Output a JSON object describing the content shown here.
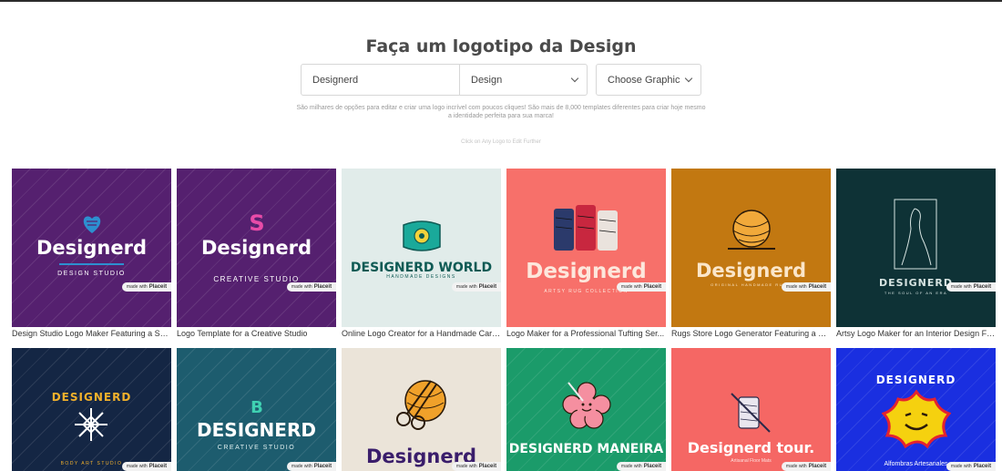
{
  "header": {
    "title": "Faça um logotipo da Design",
    "search_value": "Designerd",
    "category_select": "Design",
    "graphic_select": "Choose Graphic",
    "description": "São milhares de opções para editar e criar uma logo incrível com poucos cliques! São mais de 8,000 templates diferentes para criar hoje mesmo a identidade perfeita para sua marca!",
    "hint": "Click on Any Logo to Edit Further"
  },
  "badge": {
    "made_with": "made with",
    "brand": "Placeit"
  },
  "colors": {
    "purple": "#55206f",
    "mint": "#e1ecea",
    "coral": "#f7706a",
    "mustard": "#c27811",
    "dark_teal": "#0e3236",
    "navy": "#142644",
    "teal": "#1d5c6e",
    "beige": "#ebe4d9",
    "green": "#1b9b6a",
    "red": "#f56764",
    "blue": "#1a2fe0"
  },
  "row1": [
    {
      "brand": "Designerd",
      "sub": "DESIGN STUDIO",
      "caption": "Design Studio Logo Maker Featuring a Shi...",
      "icon": "shield-heart-icon"
    },
    {
      "brand": "Designerd",
      "sub": "CREATIVE STUDIO",
      "caption": "Logo Template for a Creative Studio",
      "icon": "letter-s-icon"
    },
    {
      "brand": "DESIGNERD WORLD",
      "sub": "HANDMADE DESIGNS",
      "caption": "Online Logo Creator for a Handmade Carp...",
      "icon": "carpet-icon"
    },
    {
      "brand": "Designerd",
      "sub": "ARTSY RUG COLLECTION",
      "caption": "Logo Maker for a Professional Tufting Ser...",
      "icon": "yarn-spools-icon"
    },
    {
      "brand": "Designerd",
      "sub": "ORIGINAL HANDMADE RUGS",
      "caption": "Rugs Store Logo Generator Featuring a Co...",
      "icon": "yarn-ball-icon"
    },
    {
      "brand": "DESIGNERD",
      "sub": "THE SOUL OF AN ERA",
      "caption": "Artsy Logo Maker for an Interior Design Firm",
      "icon": "figure-frame-icon"
    }
  ],
  "row2": [
    {
      "brand": "DESIGNERD",
      "sub": "BODY ART STUDIO",
      "icon": "snowflake-emblem-icon"
    },
    {
      "brand": "DESIGNERD",
      "sub": "CREATIVE STUDIO",
      "icon": "letter-b-icon"
    },
    {
      "brand": "Designerd",
      "sub": "",
      "icon": "scissors-yarn-icon"
    },
    {
      "brand": "DESIGNERD MANEIRA",
      "sub": "",
      "icon": "flower-face-icon"
    },
    {
      "brand": "Designerd tour.",
      "sub": "Artisanal Floor Mats",
      "icon": "spool-needle-icon"
    },
    {
      "brand": "DESIGNERD",
      "sub": "Alfombras Artesanales",
      "icon": "smiley-star-icon"
    }
  ]
}
